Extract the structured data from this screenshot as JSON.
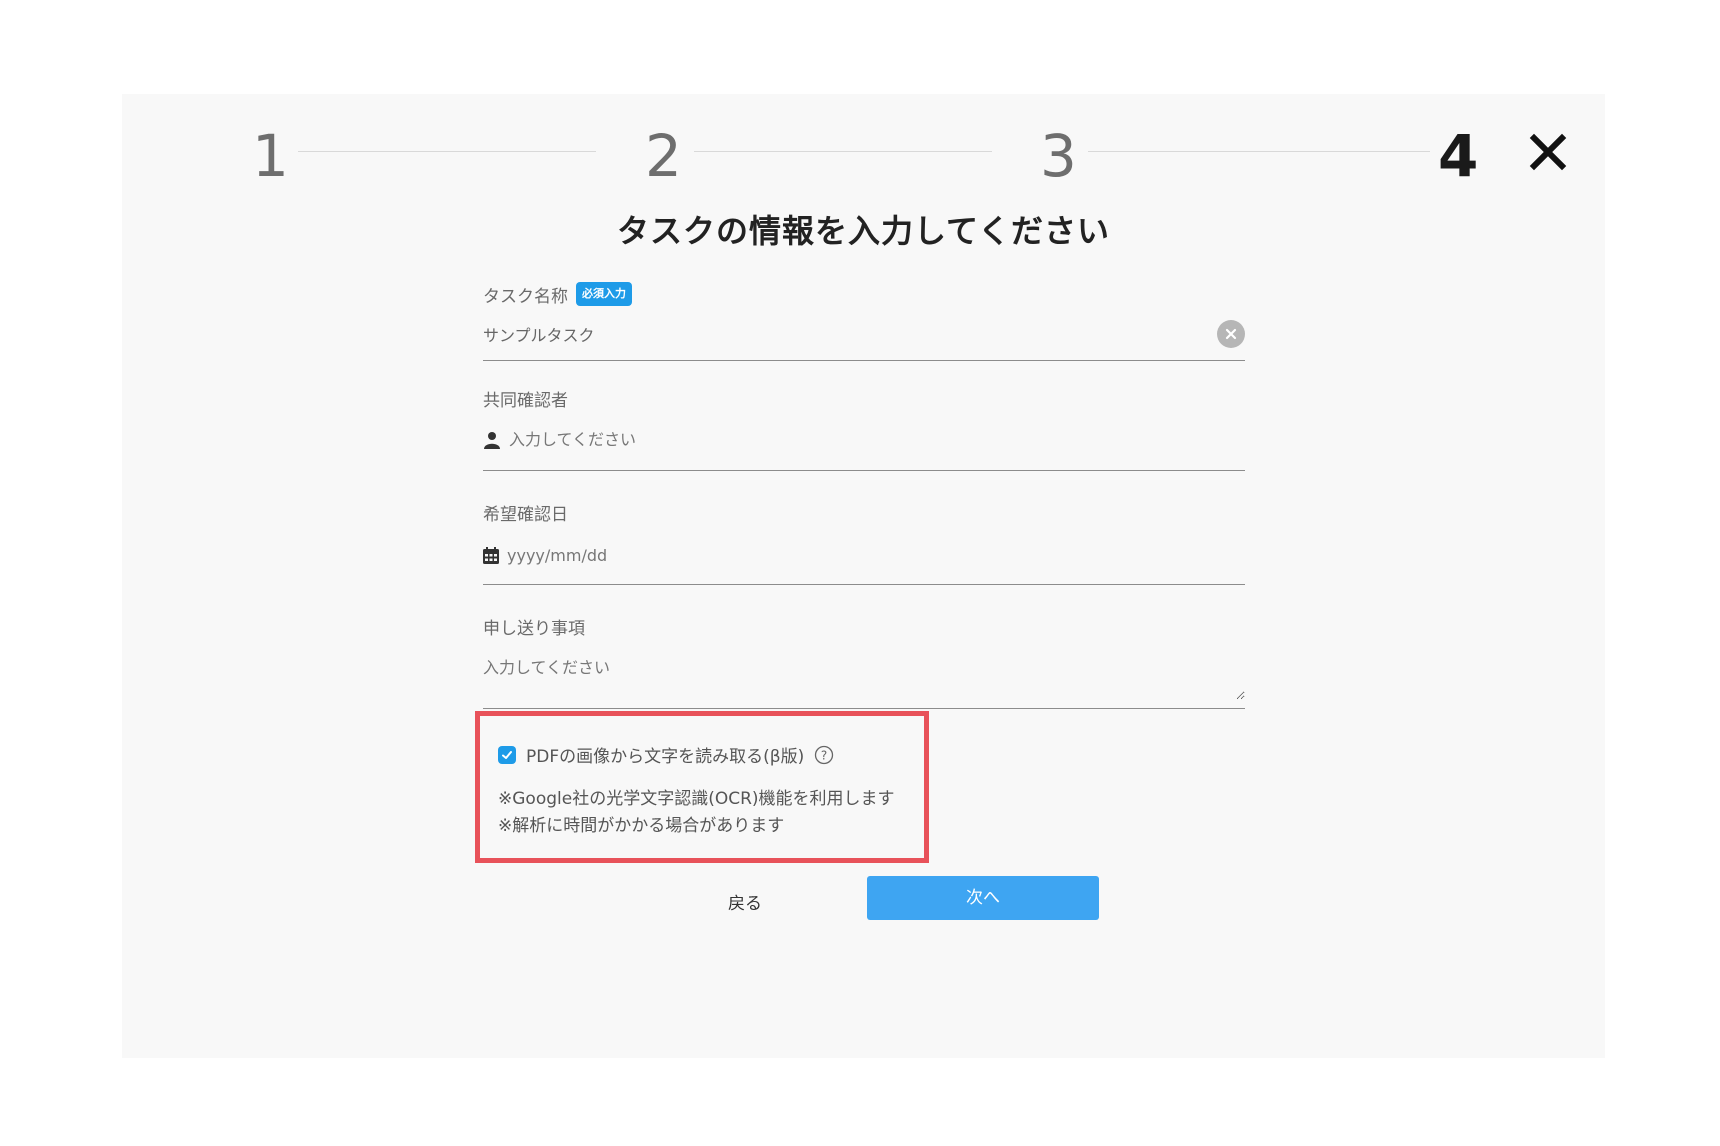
{
  "stepper": {
    "steps": [
      "1",
      "2",
      "3",
      "4"
    ],
    "active_step": "4"
  },
  "title": "タスクの情報を入力してください",
  "fields": {
    "task_name": {
      "label": "タスク名称",
      "badge": "必須入力",
      "value": "サンプルタスク"
    },
    "co_reviewer": {
      "label": "共同確認者",
      "placeholder": "入力してください"
    },
    "desired_date": {
      "label": "希望確認日",
      "placeholder": "yyyy/mm/dd"
    },
    "handover": {
      "label": "申し送り事項",
      "placeholder": "入力してください"
    }
  },
  "ocr": {
    "checked": true,
    "label": "PDFの画像から文字を読み取る(β版)",
    "notes": [
      "※Google社の光学文字認識(OCR)機能を利用します",
      "※解析に時間がかかる場合があります"
    ]
  },
  "buttons": {
    "back": "戻る",
    "next": "次へ"
  },
  "colors": {
    "accent": "#3ea5f2",
    "badge": "#1e9be8",
    "highlight": "#e8525a",
    "panel": "#f8f8f8"
  }
}
